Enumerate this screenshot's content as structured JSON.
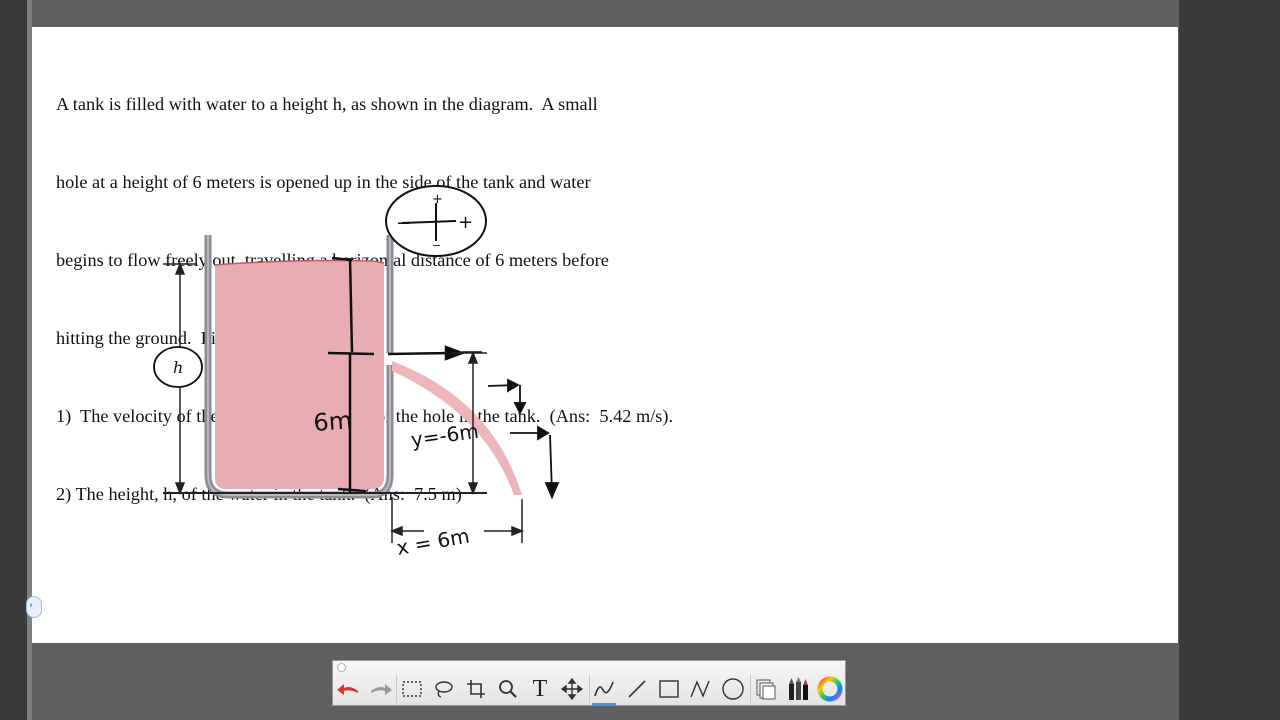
{
  "problem": {
    "lines": [
      "A tank is filled with water to a height h, as shown in the diagram.  A small",
      "hole at a height of 6 meters is opened up in the side of the tank and water",
      "begins to flow freely out, travelling a horizontal distance of 6 meters before",
      "hitting the ground.  Find:",
      "1)  The velocity of the water as it flows out of the hole in the tank.  (Ans:  5.42 m/s).",
      "2) The height, h, of the water in the tank.  (Ans:  7.5 m)"
    ]
  },
  "diagram": {
    "h_label": "h",
    "hole_height_label": "6m",
    "y_label": "y=-6m",
    "x_label": "x = 6m",
    "sign_convention": {
      "plus_top": "+",
      "minus_left": "−",
      "plus_right": "+",
      "minus_bottom": "−"
    }
  },
  "toolbar": {
    "tools": [
      {
        "name": "undo-icon"
      },
      {
        "name": "redo-icon"
      },
      {
        "name": "rect-select-icon"
      },
      {
        "name": "lasso-icon"
      },
      {
        "name": "crop-icon"
      },
      {
        "name": "zoom-icon"
      },
      {
        "name": "text-icon",
        "glyph": "T"
      },
      {
        "name": "move-icon"
      },
      {
        "name": "pen-icon"
      },
      {
        "name": "line-icon"
      },
      {
        "name": "rectangle-icon"
      },
      {
        "name": "freehand-icon"
      },
      {
        "name": "ellipse-icon"
      },
      {
        "name": "stamp-icon"
      },
      {
        "name": "markers-icon"
      },
      {
        "name": "color-wheel-icon"
      }
    ],
    "active_tool": "pen-icon"
  },
  "colors": {
    "water": "#e7adb2",
    "tank_wall": "#9a9aa2",
    "ink": "#111111",
    "toolbar_accent": "#4a90e2"
  }
}
